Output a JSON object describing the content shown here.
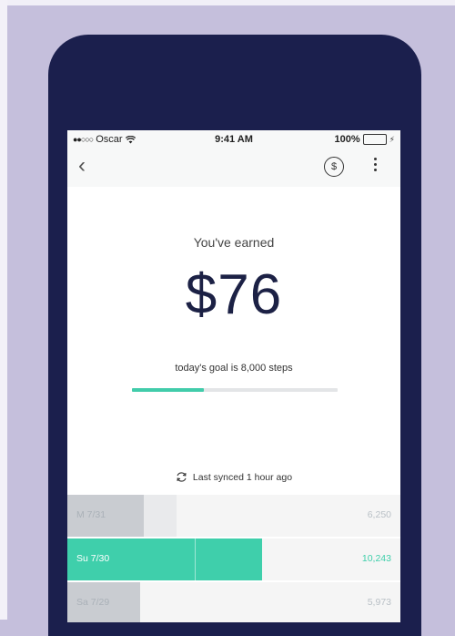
{
  "status": {
    "carrier": "Oscar",
    "time": "9:41 AM",
    "battery": "100%"
  },
  "nav": {
    "back_glyph": "‹",
    "coin_glyph": "$"
  },
  "earnings": {
    "label": "You've earned",
    "amount": "$76",
    "goal": "today's goal is 8,000 steps",
    "goal_progress_percent": 35
  },
  "sync": {
    "label": "Last synced 1 hour ago"
  },
  "days": [
    {
      "day": "M 7/31",
      "steps": "6,250",
      "active": false
    },
    {
      "day": "Su 7/30",
      "steps": "10,243",
      "active": true
    },
    {
      "day": "Sa 7/29",
      "steps": "5,973",
      "active": false
    }
  ],
  "colors": {
    "accent": "#3fcfab",
    "phone": "#1b1f4d",
    "backdrop": "#c5bfdc"
  }
}
